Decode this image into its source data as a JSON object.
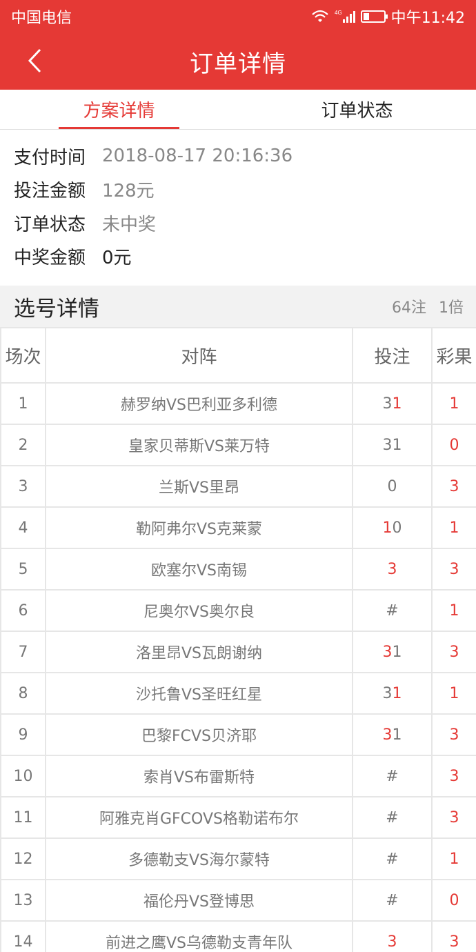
{
  "statusbar": {
    "carrier": "中国电信",
    "network": "4G",
    "time": "中午11:42"
  },
  "header": {
    "title": "订单详情"
  },
  "tabs": [
    {
      "label": "方案详情",
      "active": true
    },
    {
      "label": "订单状态",
      "active": false
    }
  ],
  "info": [
    {
      "label": "支付时间",
      "value": "2018-08-17 20:16:36"
    },
    {
      "label": "投注金额",
      "value": "128元"
    },
    {
      "label": "订单状态",
      "value": "未中奖"
    },
    {
      "label": "中奖金额",
      "value": "0元"
    }
  ],
  "selection": {
    "title": "选号详情",
    "bets": "64注",
    "multiple": "1倍"
  },
  "table": {
    "headers": [
      "场次",
      "对阵",
      "投注",
      "彩果"
    ],
    "rows": [
      {
        "no": "1",
        "match": "赫罗纳VS巴利亚多利德",
        "bet": [
          {
            "t": "3",
            "hit": false
          },
          {
            "t": "1",
            "hit": true
          }
        ],
        "result": "1"
      },
      {
        "no": "2",
        "match": "皇家贝蒂斯VS莱万特",
        "bet": [
          {
            "t": "3",
            "hit": false
          },
          {
            "t": "1",
            "hit": false
          }
        ],
        "result": "0"
      },
      {
        "no": "3",
        "match": "兰斯VS里昂",
        "bet": [
          {
            "t": "0",
            "hit": false
          }
        ],
        "result": "3"
      },
      {
        "no": "4",
        "match": "勒阿弗尔VS克莱蒙",
        "bet": [
          {
            "t": "1",
            "hit": true
          },
          {
            "t": "0",
            "hit": false
          }
        ],
        "result": "1"
      },
      {
        "no": "5",
        "match": "欧塞尔VS南锡",
        "bet": [
          {
            "t": "3",
            "hit": true
          }
        ],
        "result": "3"
      },
      {
        "no": "6",
        "match": "尼奥尔VS奥尔良",
        "bet": [
          {
            "t": "#",
            "hit": false
          }
        ],
        "result": "1"
      },
      {
        "no": "7",
        "match": "洛里昂VS瓦朗谢纳",
        "bet": [
          {
            "t": "3",
            "hit": true
          },
          {
            "t": "1",
            "hit": false
          }
        ],
        "result": "3"
      },
      {
        "no": "8",
        "match": "沙托鲁VS圣旺红星",
        "bet": [
          {
            "t": "3",
            "hit": false
          },
          {
            "t": "1",
            "hit": true
          }
        ],
        "result": "1"
      },
      {
        "no": "9",
        "match": "巴黎FCVS贝济耶",
        "bet": [
          {
            "t": "3",
            "hit": true
          },
          {
            "t": "1",
            "hit": false
          }
        ],
        "result": "3"
      },
      {
        "no": "10",
        "match": "索肖VS布雷斯特",
        "bet": [
          {
            "t": "#",
            "hit": false
          }
        ],
        "result": "3"
      },
      {
        "no": "11",
        "match": "阿雅克肖GFCOVS格勒诺布尔",
        "bet": [
          {
            "t": "#",
            "hit": false
          }
        ],
        "result": "3"
      },
      {
        "no": "12",
        "match": "多德勒支VS海尔蒙特",
        "bet": [
          {
            "t": "#",
            "hit": false
          }
        ],
        "result": "1"
      },
      {
        "no": "13",
        "match": "福伦丹VS登博思",
        "bet": [
          {
            "t": "#",
            "hit": false
          }
        ],
        "result": "0"
      },
      {
        "no": "14",
        "match": "前进之鹰VS乌德勒支青年队",
        "bet": [
          {
            "t": "3",
            "hit": true
          }
        ],
        "result": "3"
      }
    ]
  },
  "colors": {
    "accent": "#e53935",
    "muted": "#888888"
  }
}
